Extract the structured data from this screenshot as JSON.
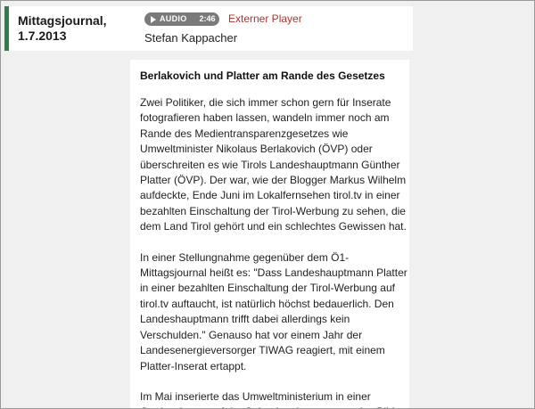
{
  "episode": {
    "show_title": "Mittagsjournal, 1.7.2013",
    "audio_label": "AUDIO",
    "audio_duration": "2:46",
    "external_player": "Externer Player",
    "author": "Stefan Kappacher"
  },
  "article": {
    "headline": "Berlakovich und Platter am Rande des Gesetzes",
    "paragraphs": [
      "Zwei Politiker, die sich immer schon gern für Inserate fotografieren haben lassen, wandeln immer noch am Rande des Medientransparenzgesetzes wie Umweltminister Nikolaus Berlakovich (ÖVP) oder überschreiten es wie Tirols Landeshauptmann Günther Platter (ÖVP). Der war, wie der Blogger Markus Wilhelm aufdeckte, Ende Juni im Lokalfernsehen tirol.tv in einer bezahlten Einschaltung der Tirol-Werbung zu sehen, die dem Land Tirol gehört und ein schlechtes Gewissen hat.",
      "In einer Stellungnahme gegenüber dem Ö1-Mittagsjournal heißt es: \"Dass Landeshauptmann Platter in einer bezahlten Einschaltung der Tirol-Werbung auf tirol.tv auftaucht, ist natürlich höchst bedauerlich. Den Landeshauptmann trifft dabei allerdings kein Verschulden.\" Genauso hat vor einem Jahr der Landesenergieversorger TIWAG reagiert, mit einem Platter-Inserat ertappt.",
      "Im Mai inserierte das Umweltministerium in einer Gratiszeitung, auf der Seite daneben prangte das Bild"
    ]
  },
  "colors": {
    "accent_bar": "#2e7d4a",
    "external_link": "#b2322a",
    "audio_button": "#7a7a7a"
  }
}
